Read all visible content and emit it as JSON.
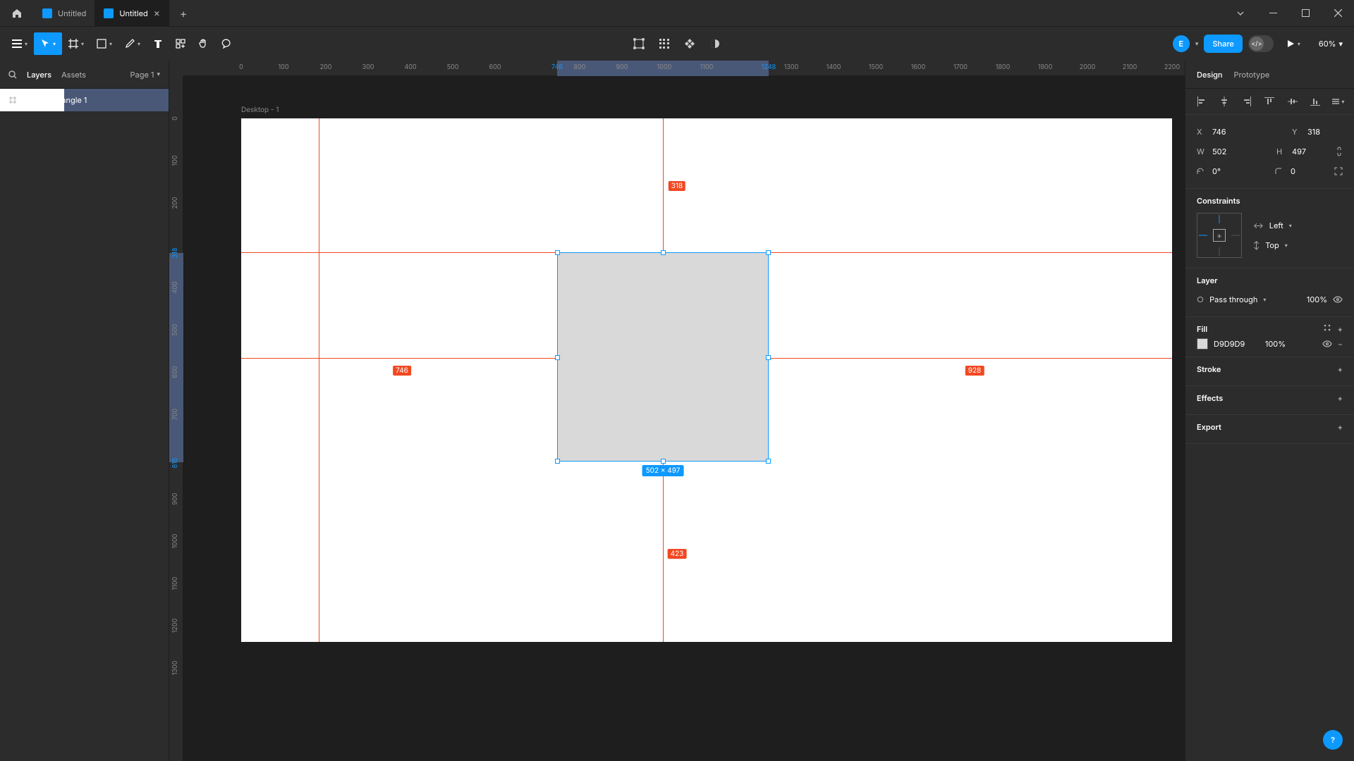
{
  "titlebar": {
    "tabs": [
      {
        "label": "Untitled",
        "active": false
      },
      {
        "label": "Untitled",
        "active": true
      }
    ]
  },
  "toolbar": {
    "zoom": "60%",
    "share": "Share",
    "avatar": "E"
  },
  "leftpanel": {
    "layers_tab": "Layers",
    "assets_tab": "Assets",
    "page": "Page 1",
    "frame_name": "Desktop - 1",
    "layer_name": "Rectangle 1"
  },
  "canvas": {
    "frame_label": "Desktop - 1",
    "dim_label": "502 × 497",
    "dist_top": "318",
    "dist_left": "746",
    "dist_right": "928",
    "dist_bottom": "423",
    "ruler_h": [
      "0",
      "100",
      "200",
      "300",
      "400",
      "500",
      "600",
      "746",
      "800",
      "900",
      "1000",
      "1100",
      "1248",
      "1300",
      "1400",
      "1500",
      "1600",
      "1700",
      "1800",
      "1900",
      "2000",
      "2100",
      "2200"
    ],
    "ruler_v": [
      "0",
      "100",
      "200",
      "318",
      "400",
      "500",
      "600",
      "700",
      "815",
      "900",
      "1000",
      "1100",
      "1200",
      "1300"
    ],
    "sel_h": {
      "start": "746",
      "end": "1248"
    },
    "sel_v": {
      "start": "318",
      "end": "815"
    }
  },
  "rightpanel": {
    "design_tab": "Design",
    "prototype_tab": "Prototype",
    "x": "746",
    "y": "318",
    "w": "502",
    "h": "497",
    "rotation": "0°",
    "radius": "0",
    "constraints_title": "Constraints",
    "constraint_h": "Left",
    "constraint_v": "Top",
    "layer_title": "Layer",
    "blend": "Pass through",
    "opacity": "100%",
    "fill_title": "Fill",
    "fill_hex": "D9D9D9",
    "fill_opacity": "100%",
    "stroke_title": "Stroke",
    "effects_title": "Effects",
    "export_title": "Export"
  }
}
